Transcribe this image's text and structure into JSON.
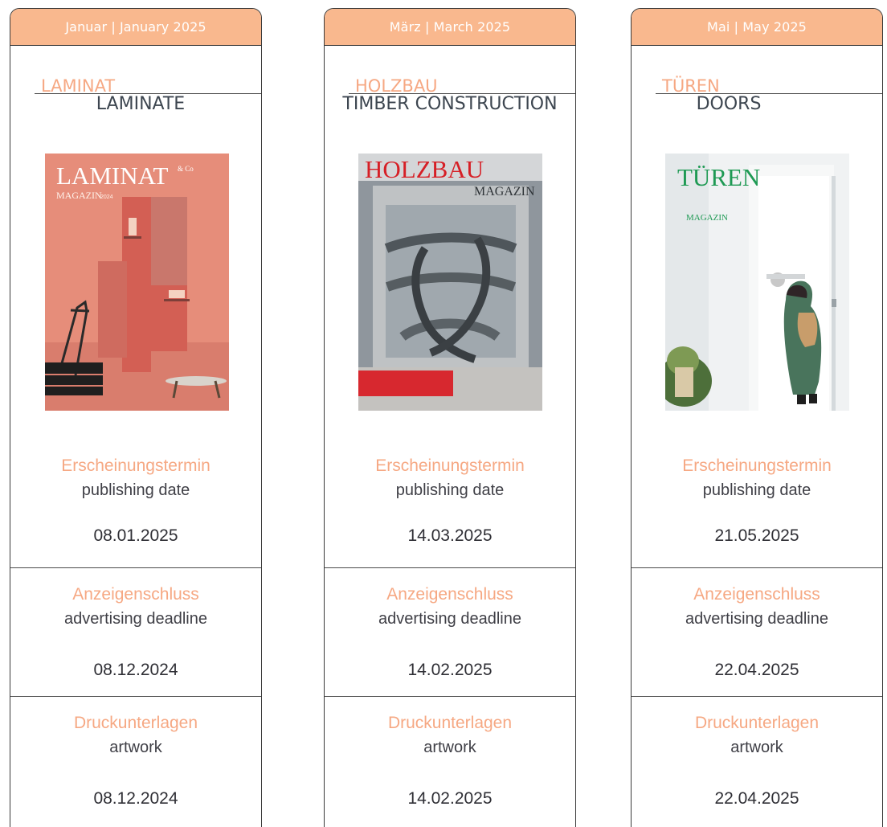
{
  "columns": [
    {
      "month": "Januar | January 2025",
      "title_de": "LAMINAT",
      "title_en": "LAMINATE",
      "cover": {
        "title": "LAMINAT",
        "subtitle": "MAGAZIN",
        "small": "& Co",
        "year": "2024",
        "colors": {
          "bg": "#e68d7a",
          "accent": "#d35f54",
          "panel": "#cb6f62"
        }
      },
      "publishing_label_de": "Erscheinungstermin",
      "publishing_label_en": "publishing date",
      "publishing_date": "08.01.2025",
      "ad_label_de": "Anzeigenschluss",
      "ad_label_en": "advertising deadline",
      "ad_date": "08.12.2024",
      "artwork_label_de": "Druckunterlagen",
      "artwork_label_en": "artwork",
      "artwork_date": "08.12.2024"
    },
    {
      "month": "März | March 2025",
      "title_de": "HOLZBAU",
      "title_en": "TIMBER CONSTRUCTION",
      "cover": {
        "title": "HOLZBAU",
        "subtitle": "MAGAZIN",
        "colors": {
          "bg": "#8f969d",
          "accent": "#d61f26",
          "panel": "#bfc2c4"
        }
      },
      "publishing_label_de": "Erscheinungstermin",
      "publishing_label_en": "publishing date",
      "publishing_date": "14.03.2025",
      "ad_label_de": "Anzeigenschluss",
      "ad_label_en": "advertising deadline",
      "ad_date": "14.02.2025",
      "artwork_label_de": "Druckunterlagen",
      "artwork_label_en": "artwork",
      "artwork_date": "14.02.2025"
    },
    {
      "month": "Mai | May 2025",
      "title_de": "TÜREN",
      "title_en": "DOORS",
      "cover": {
        "title": "TÜREN",
        "subtitle": "MAGAZIN",
        "colors": {
          "bg": "#f0f2f3",
          "accent": "#1f9a54",
          "panel": "#49745c"
        }
      },
      "publishing_label_de": "Erscheinungstermin",
      "publishing_label_en": "publishing date",
      "publishing_date": "21.05.2025",
      "ad_label_de": "Anzeigenschluss",
      "ad_label_en": "advertising deadline",
      "ad_date": "22.04.2025",
      "artwork_label_de": "Druckunterlagen",
      "artwork_label_en": "artwork",
      "artwork_date": "22.04.2025"
    }
  ]
}
